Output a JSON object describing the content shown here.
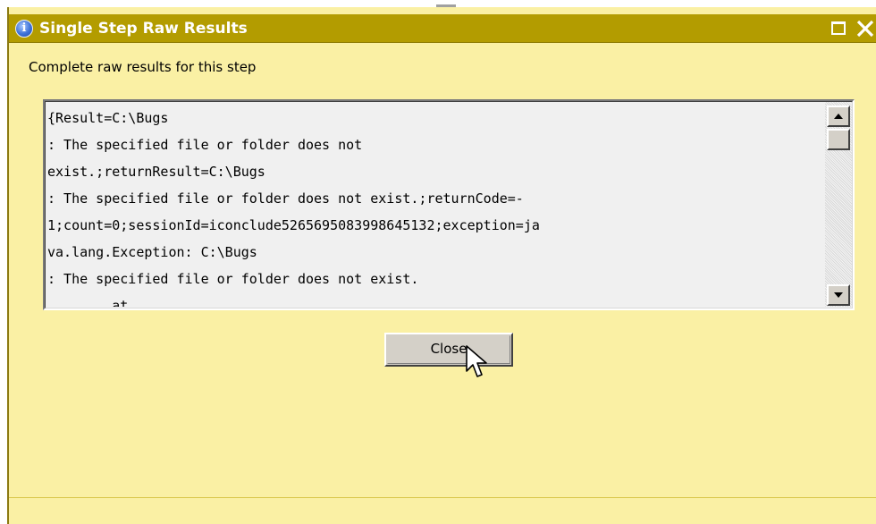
{
  "window": {
    "title": "Single Step Raw Results",
    "title_icon": "info-icon",
    "title_icon_glyph": "i",
    "controls": [
      "maximize-icon",
      "close-icon"
    ]
  },
  "subtitle": "Complete raw results for this step",
  "results": {
    "lines": [
      "{Result=C:\\Bugs",
      ": The specified file or folder does not",
      "exist.;returnResult=C:\\Bugs",
      ": The specified file or folder does not exist.;returnCode=-",
      "1;count=0;sessionId=iconclude5265695083998645132;exception=ja",
      "va.lang.Exception: C:\\Bugs",
      ": The specified file or folder does not exist.",
      "        at"
    ]
  },
  "buttons": {
    "close_label": "Close"
  },
  "colors": {
    "titlebar": "#b39c00",
    "window_background": "#faf0a4",
    "textarea_background": "#f0f0f0",
    "button_face": "#d4d0c8"
  }
}
